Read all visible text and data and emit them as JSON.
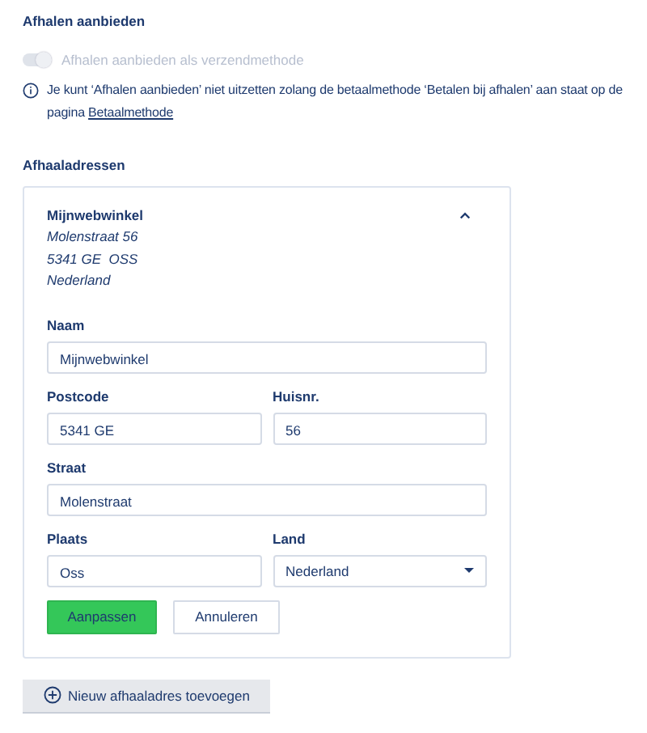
{
  "section_title": "Afhalen aanbieden",
  "toggle": {
    "label": "Afhalen aanbieden als verzendmethode",
    "on": true,
    "disabled": true
  },
  "info": {
    "text": "Je kunt ‘Afhalen aanbieden’ niet uitzetten zolang de betaalmethode ‘Betalen bij afhalen’ aan staat op de pagina",
    "link": "Betaalmethode"
  },
  "addresses_title": "Afhaaladressen",
  "address": {
    "name": "Mijnwebwinkel",
    "expanded": true,
    "lines": [
      "Molenstraat 56",
      "5341 GE  OSS",
      "Nederland"
    ],
    "field_rows": [
      [
        {
          "label": "Naam",
          "value": "Mijnwebwinkel",
          "kind": "text"
        }
      ],
      [
        {
          "label": "Postcode",
          "value": "5341 GE",
          "kind": "text"
        },
        {
          "label": "Huisnr.",
          "value": "56",
          "kind": "text"
        }
      ],
      [
        {
          "label": "Straat",
          "value": "Molenstraat",
          "kind": "text"
        }
      ],
      [
        {
          "label": "Plaats",
          "value": "Oss",
          "kind": "text"
        },
        {
          "label": "Land",
          "value": "Nederland",
          "kind": "select"
        }
      ]
    ],
    "buttons": [
      {
        "label": "Aanpassen",
        "kind": "primary"
      },
      {
        "label": "Annuleren",
        "kind": "secondary"
      }
    ]
  },
  "add_button": "Nieuw afhaaladres toevoegen"
}
